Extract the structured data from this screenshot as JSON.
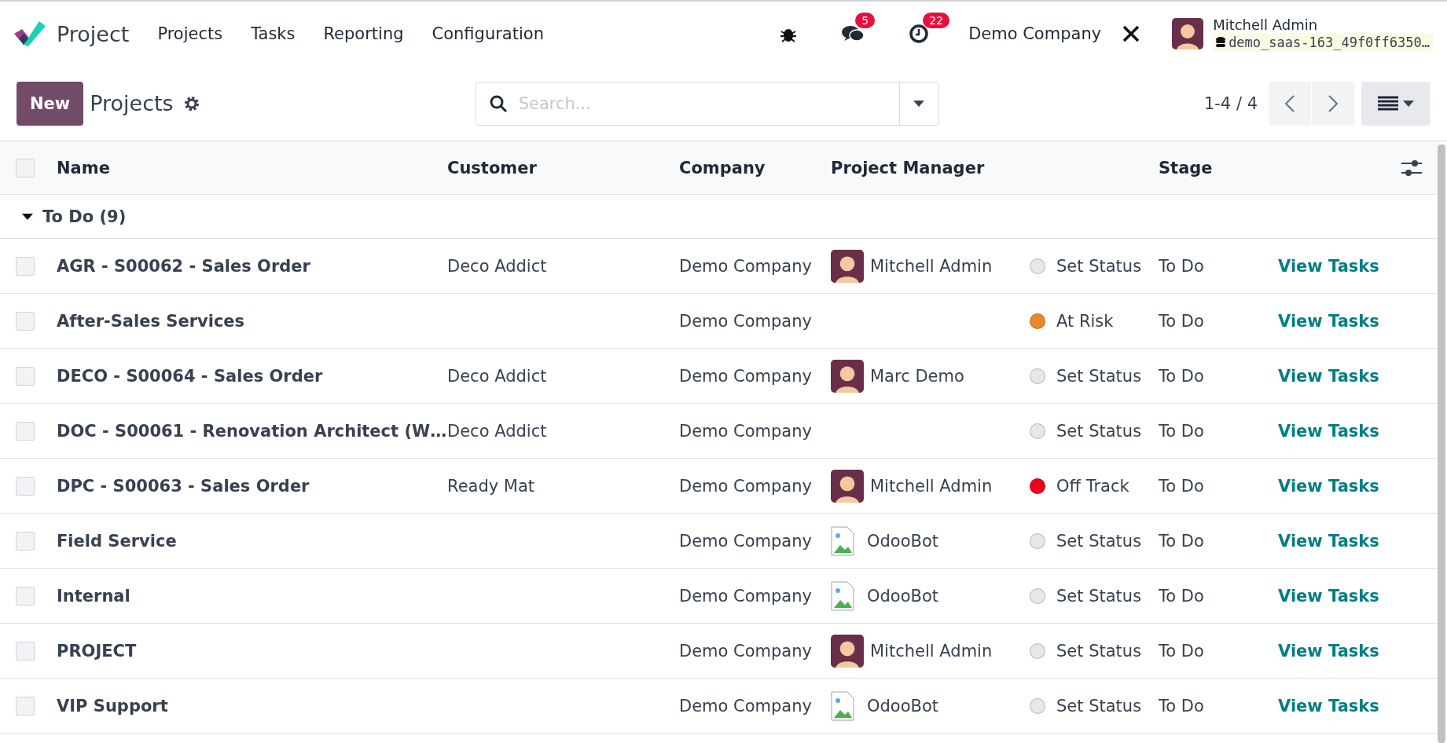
{
  "navbar": {
    "app_name": "Project",
    "menu": [
      "Projects",
      "Tasks",
      "Reporting",
      "Configuration"
    ],
    "messages_count": "5",
    "activities_count": "22",
    "company": "Demo Company",
    "user": {
      "name": "Mitchell Admin",
      "database": "demo_saas-163_49f0ff6350…"
    }
  },
  "control_panel": {
    "new_button": "New",
    "title": "Projects",
    "search": {
      "placeholder": "Search..."
    },
    "pager": "1-4 / 4"
  },
  "table": {
    "select_all_checked": false,
    "columns": [
      "Name",
      "Customer",
      "Company",
      "Project Manager",
      "Stage"
    ],
    "group": {
      "label": "To Do (9)",
      "expanded": true
    },
    "rows": [
      {
        "checked": false,
        "name": "AGR - S00062 - Sales Order",
        "customer": "Deco Addict",
        "company": "Demo Company",
        "manager": {
          "kind": "avatar",
          "name": "Mitchell Admin"
        },
        "status": {
          "label": "Set Status",
          "color": "#e5e7eb"
        },
        "stage": "To Do",
        "action": "View Tasks"
      },
      {
        "checked": false,
        "name": "After-Sales Services",
        "company": "Demo Company",
        "status": {
          "label": "At Risk",
          "color": "#e6892b"
        },
        "stage": "To Do",
        "action": "View Tasks"
      },
      {
        "checked": false,
        "name": "DECO - S00064 - Sales Order",
        "customer": "Deco Addict",
        "company": "Demo Company",
        "manager": {
          "kind": "avatar",
          "name": "Marc Demo"
        },
        "status": {
          "label": "Set Status",
          "color": "#e5e7eb"
        },
        "stage": "To Do",
        "action": "View Tasks"
      },
      {
        "checked": false,
        "name": "DOC - S00061 - Renovation Architect (W…",
        "customer": "Deco Addict",
        "company": "Demo Company",
        "status": {
          "label": "Set Status",
          "color": "#e5e7eb"
        },
        "stage": "To Do",
        "action": "View Tasks"
      },
      {
        "checked": false,
        "name": "DPC - S00063 - Sales Order",
        "customer": "Ready Mat",
        "company": "Demo Company",
        "manager": {
          "kind": "avatar",
          "name": "Mitchell Admin"
        },
        "status": {
          "label": "Off Track",
          "color": "#f0001c"
        },
        "stage": "To Do",
        "action": "View Tasks"
      },
      {
        "checked": false,
        "name": "Field Service",
        "company": "Demo Company",
        "manager": {
          "kind": "broken-image",
          "name": "OdooBot"
        },
        "status": {
          "label": "Set Status",
          "color": "#e5e7eb"
        },
        "stage": "To Do",
        "action": "View Tasks"
      },
      {
        "checked": false,
        "name": "Internal",
        "company": "Demo Company",
        "manager": {
          "kind": "broken-image",
          "name": "OdooBot"
        },
        "status": {
          "label": "Set Status",
          "color": "#e5e7eb"
        },
        "stage": "To Do",
        "action": "View Tasks"
      },
      {
        "checked": false,
        "name": "PROJECT",
        "company": "Demo Company",
        "manager": {
          "kind": "avatar",
          "name": "Mitchell Admin"
        },
        "status": {
          "label": "Set Status",
          "color": "#e5e7eb"
        },
        "stage": "To Do",
        "action": "View Tasks"
      },
      {
        "checked": false,
        "name": "VIP Support",
        "company": "Demo Company",
        "manager": {
          "kind": "broken-image",
          "name": "OdooBot"
        },
        "status": {
          "label": "Set Status",
          "color": "#e5e7eb"
        },
        "stage": "To Do",
        "action": "View Tasks"
      }
    ]
  }
}
